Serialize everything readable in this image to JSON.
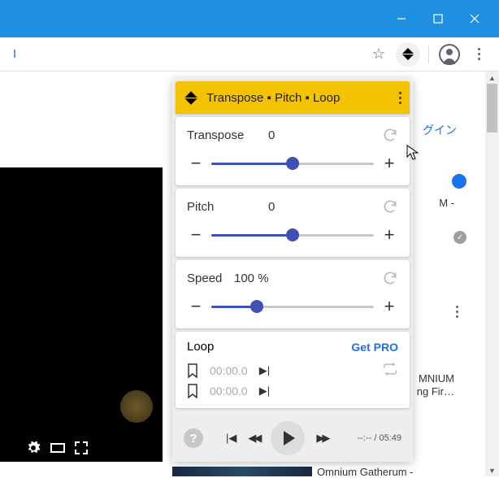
{
  "window": {
    "minimize": "—",
    "close": "✕"
  },
  "toolbar": {
    "url_hint": "I"
  },
  "popup": {
    "title": "Transpose ▪ Pitch ▪ Loop",
    "transpose": {
      "label": "Transpose",
      "value": "0"
    },
    "pitch": {
      "label": "Pitch",
      "value": "0"
    },
    "speed": {
      "label": "Speed",
      "value": "100 %"
    },
    "loop": {
      "label": "Loop",
      "pro": "Get PRO",
      "t1": "00:00.0",
      "t2": "00:00.0"
    },
    "player": {
      "help": "?",
      "time": "--:-- / 05:49"
    }
  },
  "bg": {
    "login": "グイン",
    "m": "M -",
    "thumb1a": "MNIUM",
    "thumb1b": "ng Fir…",
    "thumb2": "Omnium Gatherum -"
  },
  "symbols": {
    "minus": "−",
    "plus": "+",
    "skip_next": "▶|",
    "prev": "|◀",
    "rew": "◀◀",
    "fwd": "▶▶",
    "check": "✓",
    "star": "☆"
  }
}
